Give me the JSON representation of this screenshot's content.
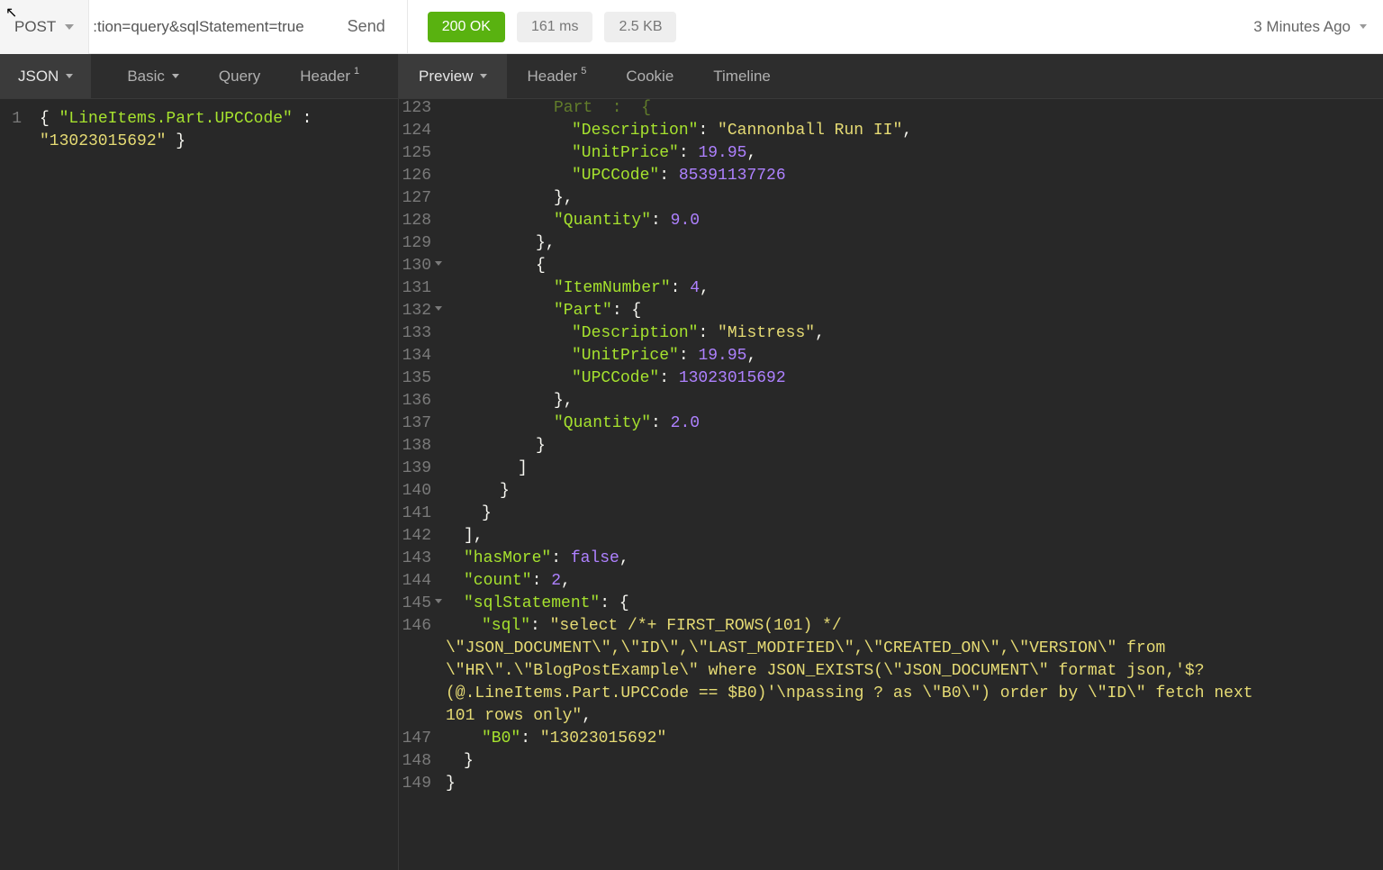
{
  "topbar": {
    "method": "POST",
    "url_fragment": ":tion=query&sqlStatement=true",
    "send": "Send",
    "status": "200 OK",
    "latency": "161 ms",
    "size": "2.5 KB",
    "time": "3 Minutes Ago"
  },
  "left_tabs": {
    "json": "JSON",
    "basic": "Basic",
    "query": "Query",
    "header": "Header",
    "header_badge": "1"
  },
  "right_tabs": {
    "preview": "Preview",
    "header": "Header",
    "header_badge": "5",
    "cookie": "Cookie",
    "timeline": "Timeline"
  },
  "request_body": {
    "line_no": "1",
    "key": "\"LineItems.Part.UPCCode\"",
    "value": "\"13023015692\""
  },
  "response": {
    "items": [
      {
        "ItemNumber": null,
        "Part": {
          "Description": "Cannonball Run II",
          "UnitPrice": 19.95,
          "UPCCode": 85391137726
        },
        "Quantity": 9.0
      },
      {
        "ItemNumber": 4,
        "Part": {
          "Description": "Mistress",
          "UnitPrice": 19.95,
          "UPCCode": 13023015692
        },
        "Quantity": 2.0
      }
    ],
    "hasMore": false,
    "count": 2,
    "sqlStatement": {
      "sql": "select /*+ FIRST_ROWS(101) */ \\\"JSON_DOCUMENT\\\",\\\"ID\\\",\\\"LAST_MODIFIED\\\",\\\"CREATED_ON\\\",\\\"VERSION\\\" from \\\"HR\\\".\\\"BlogPostExample\\\" where JSON_EXISTS(\\\"JSON_DOCUMENT\\\" format json,'$?(@.LineItems.Part.UPCCode == $B0)'\\npassing ? as \\\"B0\\\") order by \\\"ID\\\" fetch next 101 rows only",
      "B0": "13023015692"
    },
    "lines": {
      "l123": "123",
      "l124": "124",
      "l125": "125",
      "l126": "126",
      "l127": "127",
      "l128": "128",
      "l129": "129",
      "l130": "130",
      "l131": "131",
      "l132": "132",
      "l133": "133",
      "l134": "134",
      "l135": "135",
      "l136": "136",
      "l137": "137",
      "l138": "138",
      "l139": "139",
      "l140": "140",
      "l141": "141",
      "l142": "142",
      "l143": "143",
      "l144": "144",
      "l145": "145",
      "l146": "146",
      "l147": "147",
      "l148": "148",
      "l149": "149"
    },
    "strings": {
      "part_key": "\"Part\"",
      "desc_key": "\"Description\"",
      "unitprice_key": "\"UnitPrice\"",
      "upccode_key": "\"UPCCode\"",
      "quantity_key": "\"Quantity\"",
      "itemno_key": "\"ItemNumber\"",
      "hasmore_key": "\"hasMore\"",
      "count_key": "\"count\"",
      "sqlstmt_key": "\"sqlStatement\"",
      "sql_key": "\"sql\"",
      "b0_key": "\"B0\"",
      "desc1": "\"Cannonball Run II\"",
      "desc2": "\"Mistress\"",
      "b0_val": "\"13023015692\"",
      "sql_l1": "\"select /*+ FIRST_ROWS(101) */ ",
      "sql_l2": "\\\"JSON_DOCUMENT\\\",\\\"ID\\\",\\\"LAST_MODIFIED\\\",\\\"CREATED_ON\\\",\\\"VERSION\\\" from ",
      "sql_l3": "\\\"HR\\\".\\\"BlogPostExample\\\" where JSON_EXISTS(\\\"JSON_DOCUMENT\\\" format json,'$?",
      "sql_l4": "(@.LineItems.Part.UPCCode == $B0)'\\npassing ? as \\\"B0\\\") order by \\\"ID\\\" fetch next ",
      "sql_l5": "101 rows only\"",
      "price": "19.95",
      "upc1": "85391137726",
      "upc2": "13023015692",
      "q1": "9.0",
      "q2": "2.0",
      "count": "2",
      "itemno4": "4",
      "false": "false",
      "part_open_frag": "Part  :  {"
    }
  }
}
